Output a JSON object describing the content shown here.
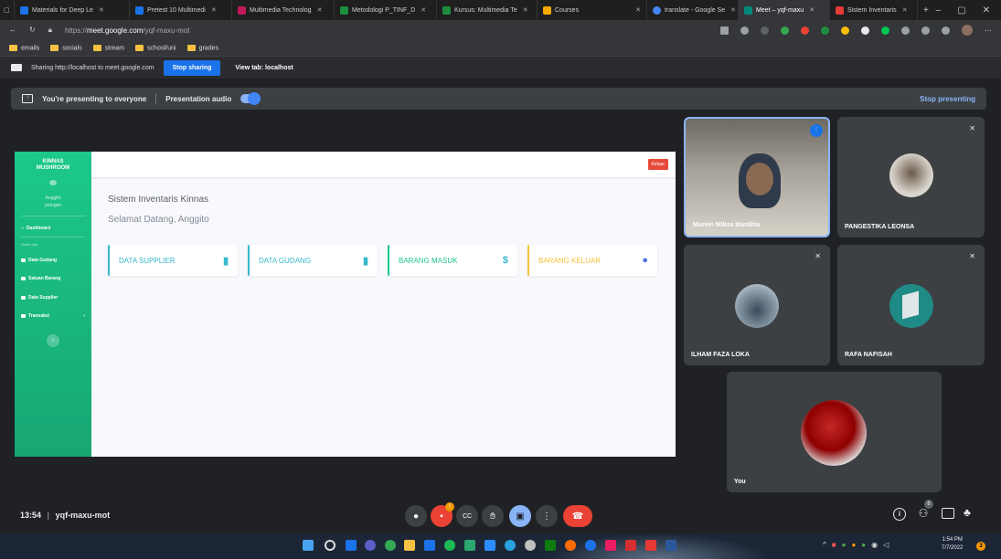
{
  "browser": {
    "tabs": [
      {
        "label": "Materials for Deep Le",
        "color": "#1a73e8"
      },
      {
        "label": "Pretest 10 Multimedi",
        "color": "#1a73e8"
      },
      {
        "label": "Multimedia Technolog",
        "color": "#c2185b"
      },
      {
        "label": "Metodologi P_TINF_D",
        "color": "#1e8e3e"
      },
      {
        "label": "Kursus: Multimedia Te",
        "color": "#1e8e3e"
      },
      {
        "label": "Courses",
        "color": "#f9ab00"
      },
      {
        "label": "translate - Google Se",
        "color": "#4285f4"
      },
      {
        "label": "Meet – yqf-maxu",
        "color": "#00897b",
        "active": true
      },
      {
        "label": "Sistem Inventaris",
        "color": "#e53935"
      }
    ],
    "url_prefix": "https://",
    "url_host": "meet.google.com",
    "url_path": "/yqf-maxu-mot",
    "bookmarks": [
      "emails",
      "socials",
      "stream",
      "school/uni",
      "grades"
    ]
  },
  "sharing": {
    "text": "Sharing http://localhost to meet.google.com",
    "stop_label": "Stop sharing",
    "view_label": "View tab: localhost"
  },
  "presenting": {
    "text": "You're presenting to everyone",
    "audio_label": "Presentation audio",
    "stop_label": "Stop presenting"
  },
  "app": {
    "brand_line1": "KINNAS",
    "brand_line2": "MUSHROOM",
    "user_name": "Anggito",
    "user_role": "petugas",
    "dashboard": "Dashboard",
    "section": "Master data",
    "menu": [
      "Data Gudang",
      "Satuan Barang",
      "Data Supplier",
      "Transaksi"
    ],
    "logout": "Keluar",
    "title": "Sistem Inventaris Kinnas",
    "welcome": "Selamat Datang, Anggito",
    "cards": [
      {
        "label": "DATA SUPPLIER",
        "color": "#36b9cc",
        "icon": "▮"
      },
      {
        "label": "DATA GUDANG",
        "color": "#36b9cc",
        "icon": "▮"
      },
      {
        "label": "BARANG MASUK",
        "color": "#1cc88a",
        "icon": "$"
      },
      {
        "label": "BARANG KELUAR",
        "color": "#f6c23e",
        "icon": "●"
      }
    ]
  },
  "participants": [
    {
      "name": "Murein Miksa Mardhia"
    },
    {
      "name": "PANGESTIKA LEONSA"
    },
    {
      "name": "ILHAM FAZA LOKA"
    },
    {
      "name": "RAFA NAFISAH"
    },
    {
      "name": "You"
    }
  ],
  "meeting": {
    "time": "13:54",
    "code": "yqf-maxu-mot",
    "people_count": "6",
    "chat_badge": "1"
  },
  "taskbar": {
    "time": "1:54 PM",
    "date": "7/7/2022",
    "notif": "3"
  }
}
